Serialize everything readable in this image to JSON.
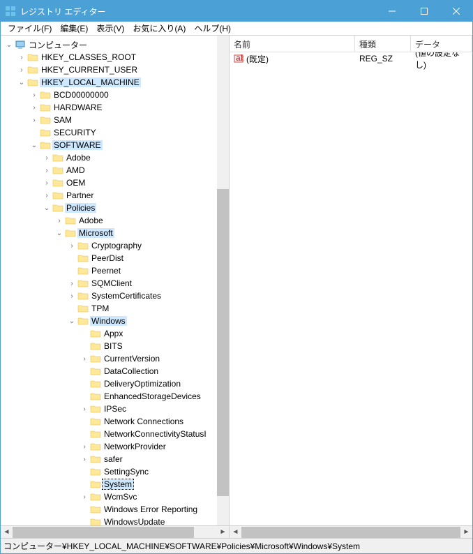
{
  "window": {
    "title": "レジストリ エディター"
  },
  "menu": {
    "file": "ファイル(F)",
    "edit": "編集(E)",
    "view": "表示(V)",
    "fav": "お気に入り(A)",
    "help": "ヘルプ(H)"
  },
  "tree": [
    {
      "d": 0,
      "tw": "open",
      "icon": "computer",
      "label": "コンピューター",
      "path": false
    },
    {
      "d": 1,
      "tw": "closed",
      "icon": "folder",
      "label": "HKEY_CLASSES_ROOT",
      "path": false
    },
    {
      "d": 1,
      "tw": "closed",
      "icon": "folder",
      "label": "HKEY_CURRENT_USER",
      "path": false
    },
    {
      "d": 1,
      "tw": "open",
      "icon": "folder",
      "label": "HKEY_LOCAL_MACHINE",
      "path": true
    },
    {
      "d": 2,
      "tw": "closed",
      "icon": "folder",
      "label": "BCD00000000",
      "path": false
    },
    {
      "d": 2,
      "tw": "closed",
      "icon": "folder",
      "label": "HARDWARE",
      "path": false
    },
    {
      "d": 2,
      "tw": "closed",
      "icon": "folder",
      "label": "SAM",
      "path": false
    },
    {
      "d": 2,
      "tw": "none",
      "icon": "folder",
      "label": "SECURITY",
      "path": false
    },
    {
      "d": 2,
      "tw": "open",
      "icon": "folder",
      "label": "SOFTWARE",
      "path": true
    },
    {
      "d": 3,
      "tw": "closed",
      "icon": "folder",
      "label": "Adobe",
      "path": false
    },
    {
      "d": 3,
      "tw": "closed",
      "icon": "folder",
      "label": "AMD",
      "path": false
    },
    {
      "d": 3,
      "tw": "closed",
      "icon": "folder",
      "label": "OEM",
      "path": false
    },
    {
      "d": 3,
      "tw": "closed",
      "icon": "folder",
      "label": "Partner",
      "path": false
    },
    {
      "d": 3,
      "tw": "open",
      "icon": "folder",
      "label": "Policies",
      "path": true
    },
    {
      "d": 4,
      "tw": "closed",
      "icon": "folder",
      "label": "Adobe",
      "path": false
    },
    {
      "d": 4,
      "tw": "open",
      "icon": "folder",
      "label": "Microsoft",
      "path": true
    },
    {
      "d": 5,
      "tw": "closed",
      "icon": "folder",
      "label": "Cryptography",
      "path": false
    },
    {
      "d": 5,
      "tw": "none",
      "icon": "folder",
      "label": "PeerDist",
      "path": false
    },
    {
      "d": 5,
      "tw": "none",
      "icon": "folder",
      "label": "Peernet",
      "path": false
    },
    {
      "d": 5,
      "tw": "closed",
      "icon": "folder",
      "label": "SQMClient",
      "path": false
    },
    {
      "d": 5,
      "tw": "closed",
      "icon": "folder",
      "label": "SystemCertificates",
      "path": false
    },
    {
      "d": 5,
      "tw": "none",
      "icon": "folder",
      "label": "TPM",
      "path": false
    },
    {
      "d": 5,
      "tw": "open",
      "icon": "folder",
      "label": "Windows",
      "path": true
    },
    {
      "d": 6,
      "tw": "none",
      "icon": "folder",
      "label": "Appx",
      "path": false
    },
    {
      "d": 6,
      "tw": "none",
      "icon": "folder",
      "label": "BITS",
      "path": false
    },
    {
      "d": 6,
      "tw": "closed",
      "icon": "folder",
      "label": "CurrentVersion",
      "path": false
    },
    {
      "d": 6,
      "tw": "none",
      "icon": "folder",
      "label": "DataCollection",
      "path": false
    },
    {
      "d": 6,
      "tw": "none",
      "icon": "folder",
      "label": "DeliveryOptimization",
      "path": false
    },
    {
      "d": 6,
      "tw": "none",
      "icon": "folder",
      "label": "EnhancedStorageDevices",
      "path": false
    },
    {
      "d": 6,
      "tw": "closed",
      "icon": "folder",
      "label": "IPSec",
      "path": false
    },
    {
      "d": 6,
      "tw": "none",
      "icon": "folder",
      "label": "Network Connections",
      "path": false
    },
    {
      "d": 6,
      "tw": "none",
      "icon": "folder",
      "label": "NetworkConnectivityStatusI",
      "path": false
    },
    {
      "d": 6,
      "tw": "closed",
      "icon": "folder",
      "label": "NetworkProvider",
      "path": false
    },
    {
      "d": 6,
      "tw": "closed",
      "icon": "folder",
      "label": "safer",
      "path": false
    },
    {
      "d": 6,
      "tw": "none",
      "icon": "folder",
      "label": "SettingSync",
      "path": false
    },
    {
      "d": 6,
      "tw": "none",
      "icon": "folder",
      "label": "System",
      "path": true,
      "selected": true
    },
    {
      "d": 6,
      "tw": "closed",
      "icon": "folder",
      "label": "WcmSvc",
      "path": false
    },
    {
      "d": 6,
      "tw": "none",
      "icon": "folder",
      "label": "Windows Error Reporting",
      "path": false
    },
    {
      "d": 6,
      "tw": "none",
      "icon": "folder",
      "label": "WindowsUpdate",
      "path": false
    }
  ],
  "columns": {
    "name": "名前",
    "type": "種類",
    "data": "データ"
  },
  "values": [
    {
      "name": "(既定)",
      "type": "REG_SZ",
      "data": "(値の設定なし)"
    }
  ],
  "status": "コンピューター¥HKEY_LOCAL_MACHINE¥SOFTWARE¥Policies¥Microsoft¥Windows¥System"
}
